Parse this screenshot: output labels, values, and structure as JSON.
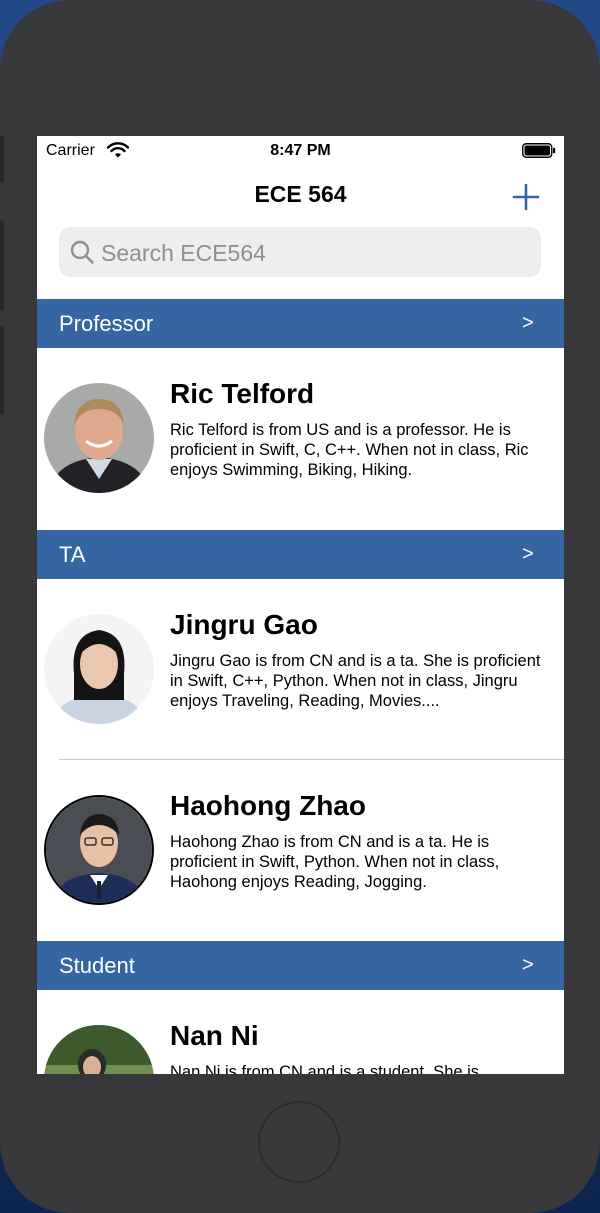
{
  "status_bar": {
    "carrier": "Carrier",
    "time": "8:47 PM"
  },
  "nav": {
    "title": "ECE 564",
    "add_icon": "plus-icon"
  },
  "search": {
    "placeholder": "Search ECE564",
    "value": ""
  },
  "colors": {
    "section_header_bg": "#3565A3",
    "tint": "#3565A3",
    "device_frame": "#38383A"
  },
  "sections": [
    {
      "title": "Professor",
      "chevron": ">",
      "rows": [
        {
          "name": "Ric Telford",
          "description": "Ric Telford is from US and is a professor. He is proficient in Swift, C, C++. When not in class, Ric enjoys Swimming, Biking, Hiking."
        }
      ]
    },
    {
      "title": "TA",
      "chevron": ">",
      "rows": [
        {
          "name": "Jingru Gao",
          "description": "Jingru Gao is from CN and is a ta. She is proficient in Swift, C++, Python. When not in class, Jingru enjoys Traveling, Reading, Movies...."
        },
        {
          "name": "Haohong Zhao",
          "description": "Haohong Zhao is from CN and is a ta. He is proficient in Swift, Python. When not in class, Haohong enjoys Reading, Jogging."
        }
      ]
    },
    {
      "title": "Student",
      "chevron": ">",
      "rows": [
        {
          "name": "Nan Ni",
          "description": "Nan Ni is from CN and is a student. She is"
        }
      ]
    }
  ]
}
